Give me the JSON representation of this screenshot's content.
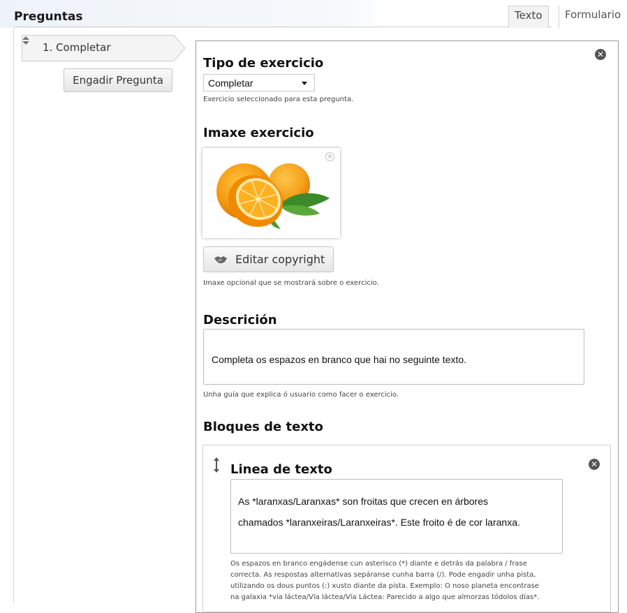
{
  "header": {
    "title": "Preguntas",
    "tabs": [
      {
        "label": "Texto"
      },
      {
        "label": "Formulario"
      }
    ]
  },
  "questions": {
    "items": [
      {
        "label": "1. Completar"
      }
    ],
    "add_button_label": "Engadir Pregunta"
  },
  "form": {
    "exercise_type": {
      "title": "Tipo de exercicio",
      "selected": "Completar",
      "help": "Exercicio seleccionado para esta pregunta."
    },
    "exercise_image": {
      "title": "Imaxe exercicio",
      "copyright_button_label": "Editar copyright",
      "help": "Imaxe opcional que se mostrará sobre o exercicio."
    },
    "description": {
      "title": "Descrición",
      "value": "Completa os espazos en branco que hai no seguinte texto.",
      "help": "Unha guía que explica ó usuario como facer o exercicio."
    },
    "text_blocks": {
      "title": "Bloques de texto",
      "items": [
        {
          "title": "Linea de texto",
          "text_line1": "As *laranxas/Laranxas* son froitas que crecen en árbores",
          "text_line2": "chamados *laranxeiras/Laranxeiras*. Este froito é de cor laranxa.",
          "help_line1": "Os espazos en branco engádense cun asterisco (*) diante e detrás da palabra / frase",
          "help_line2": "correcta. As respostas alternativas sepáranse cunha barra (/). Pode engadir unha pista,",
          "help_line3": "utilizando os dous puntos (:) xusto diante da pista. Exemplo: O noso planeta encontrase",
          "help_line4": "na galaxia *vía láctea/Vía láctea/Vía Láctea: Parecido a algo que almorzas tódolos días*."
        }
      ]
    }
  },
  "colors": {
    "header_gradient_left": "#eef3f9",
    "button_bg": "#e6e6e6",
    "close_icon": "#555555"
  }
}
